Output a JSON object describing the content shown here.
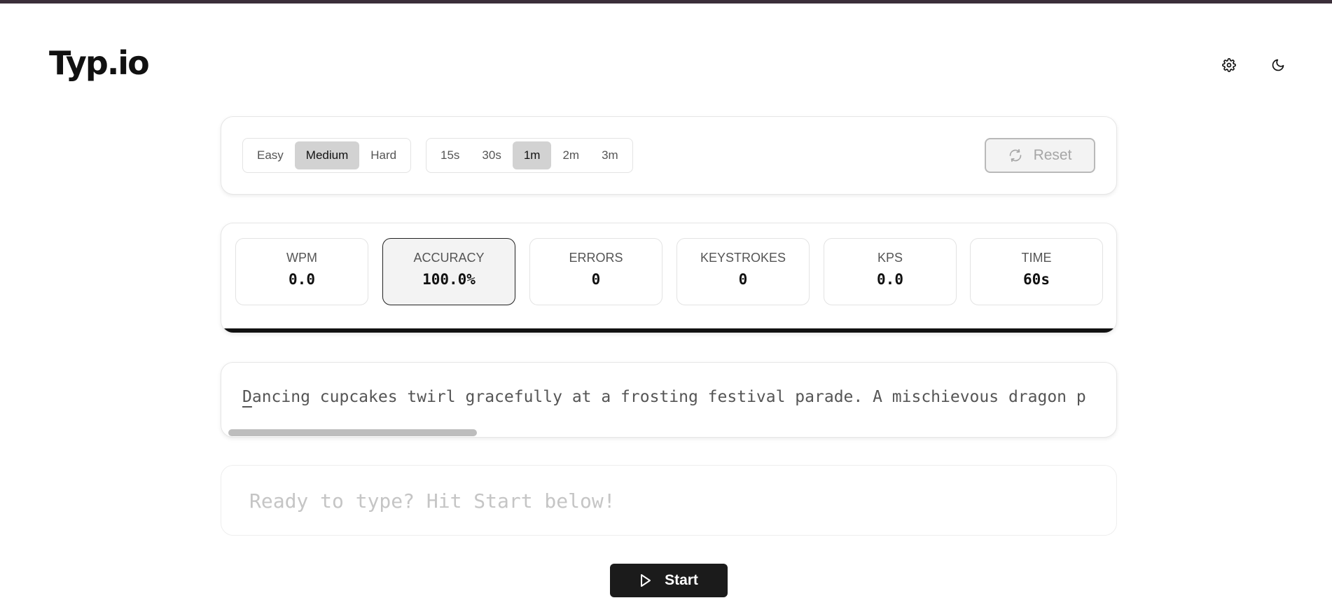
{
  "app": {
    "logo": "Typ.io"
  },
  "header": {
    "settings_icon": "gear-icon",
    "theme_icon": "moon-icon"
  },
  "controls": {
    "difficulty": [
      {
        "label": "Easy",
        "active": false
      },
      {
        "label": "Medium",
        "active": true
      },
      {
        "label": "Hard",
        "active": false
      }
    ],
    "durations": [
      {
        "label": "15s",
        "active": false
      },
      {
        "label": "30s",
        "active": false
      },
      {
        "label": "1m",
        "active": true
      },
      {
        "label": "2m",
        "active": false
      },
      {
        "label": "3m",
        "active": false
      }
    ],
    "reset_label": "Reset",
    "reset_icon": "refresh-icon"
  },
  "stats": [
    {
      "label": "WPM",
      "value": "0.0"
    },
    {
      "label": "ACCURACY",
      "value": "100.0%"
    },
    {
      "label": "ERRORS",
      "value": "0"
    },
    {
      "label": "KEYSTROKES",
      "value": "0"
    },
    {
      "label": "KPS",
      "value": "0.0"
    },
    {
      "label": "TIME",
      "value": "60s"
    }
  ],
  "passage": {
    "first_char": "D",
    "rest": "ancing cupcakes twirl gracefully at a frosting festival parade. A mischievous dragon p"
  },
  "typing": {
    "placeholder": "Ready to type? Hit Start below!"
  },
  "start": {
    "label": "Start",
    "icon": "play-icon"
  },
  "colors": {
    "top_bar": "#3b2f3a",
    "active_segment": "#d2d2d2",
    "start_button": "#1b1b1b"
  }
}
